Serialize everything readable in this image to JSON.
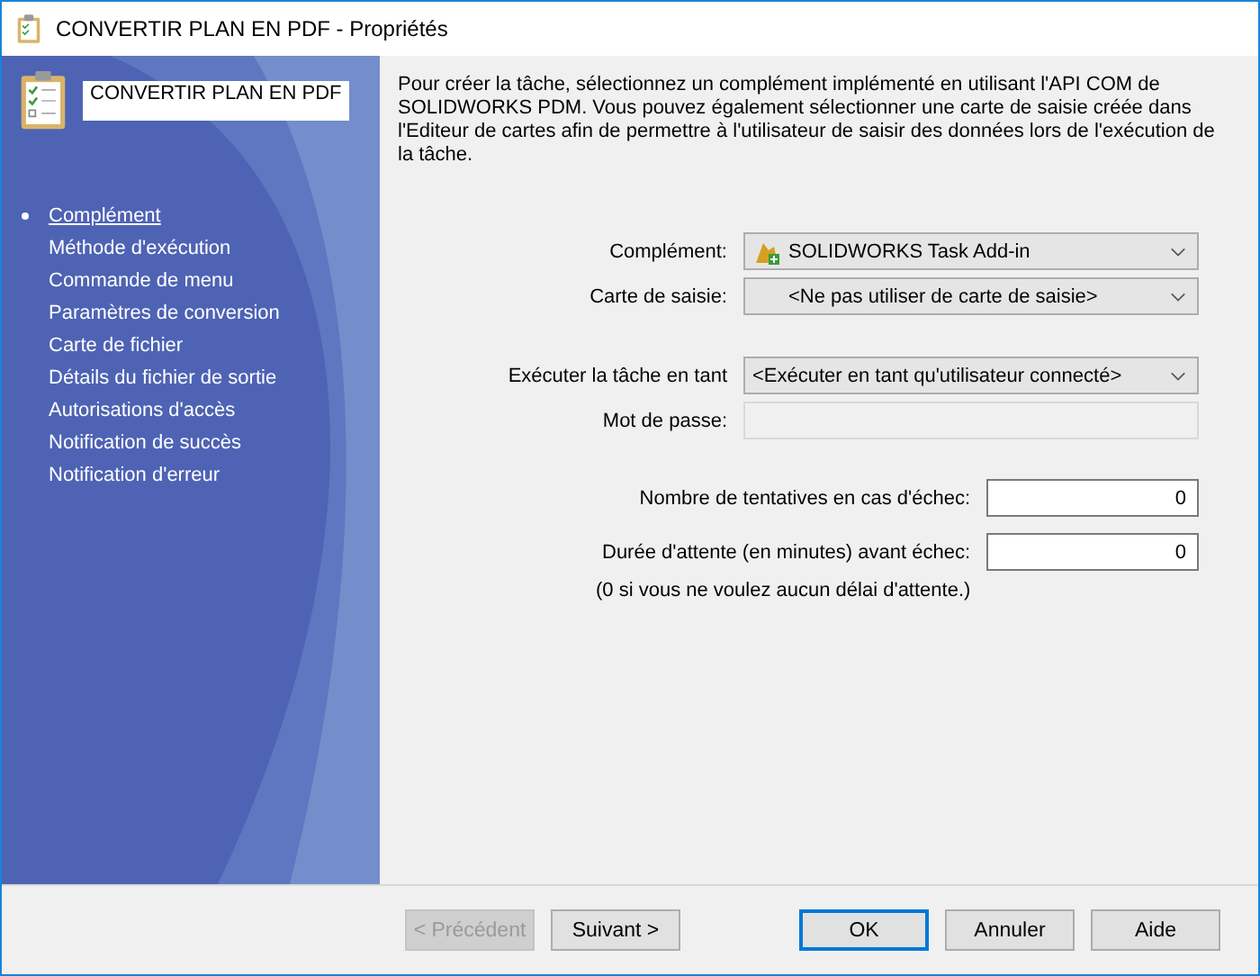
{
  "window": {
    "title": "CONVERTIR PLAN EN PDF - Propriétés"
  },
  "sidebar": {
    "name_field": "CONVERTIR PLAN EN PDF",
    "items": [
      {
        "label": "Complément",
        "selected": true
      },
      {
        "label": "Méthode d'exécution",
        "selected": false
      },
      {
        "label": "Commande de menu",
        "selected": false
      },
      {
        "label": "Paramètres de conversion",
        "selected": false
      },
      {
        "label": "Carte de fichier",
        "selected": false
      },
      {
        "label": "Détails du fichier de sortie",
        "selected": false
      },
      {
        "label": "Autorisations d'accès",
        "selected": false
      },
      {
        "label": "Notification de succès",
        "selected": false
      },
      {
        "label": "Notification d'erreur",
        "selected": false
      }
    ]
  },
  "description": "Pour créer la tâche, sélectionnez un complément implémenté en utilisant l'API COM de SOLIDWORKS PDM. Vous pouvez également sélectionner une carte de saisie créée dans l'Editeur de cartes afin de permettre à l'utilisateur de saisir des données lors de l'exécution de la tâche.",
  "form_groups": [
    [
      {
        "kind": "dropdown",
        "label": "Complément:",
        "value": "SOLIDWORKS Task Add-in",
        "has_icon": true
      },
      {
        "kind": "dropdown",
        "label": "Carte de saisie:",
        "value": "<Ne pas utiliser de carte de saisie>",
        "has_icon": false
      }
    ],
    [
      {
        "kind": "dropdown",
        "label": "Exécuter la tâche en tant",
        "value": "<Exécuter en tant qu'utilisateur connecté>",
        "has_icon": false
      },
      {
        "kind": "text",
        "label": "Mot de passe:",
        "disabled": true
      }
    ]
  ],
  "retry": {
    "fields": [
      {
        "label": "Nombre de tentatives en cas d'échec:",
        "value": "0"
      },
      {
        "label": "Durée d'attente (en minutes) avant échec:",
        "value": "0"
      }
    ],
    "note": "(0 si vous ne voulez aucun délai d'attente.)"
  },
  "buttons": [
    {
      "label": "< Précédent",
      "disabled": true,
      "default": false
    },
    {
      "label": "Suivant >",
      "disabled": false,
      "default": false
    },
    {
      "label": "OK",
      "disabled": false,
      "default": true
    },
    {
      "label": "Annuler",
      "disabled": false,
      "default": false
    },
    {
      "label": "Aide",
      "disabled": false,
      "default": false
    }
  ]
}
